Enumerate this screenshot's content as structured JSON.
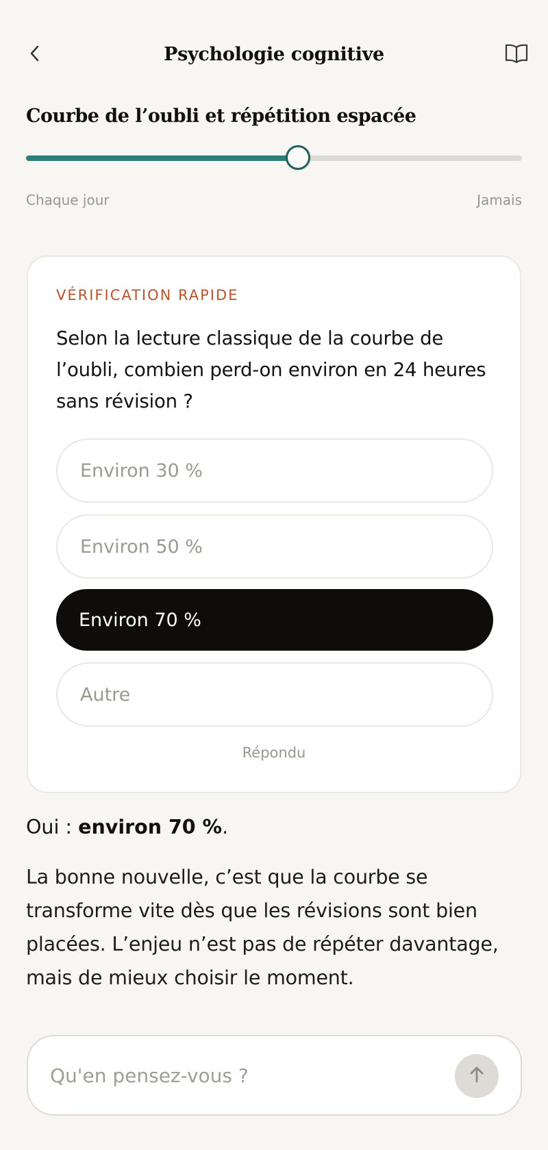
{
  "header": {
    "title": "Psychologie cognitive",
    "back_icon": "chevron-left-icon",
    "book_icon": "open-book-icon"
  },
  "lesson": {
    "title": "Courbe de l’oubli et répétition espacée"
  },
  "slider": {
    "value_fraction": 0.55,
    "min_label": "Chaque jour",
    "max_label": "Jamais",
    "fill_color": "#2f7d7c"
  },
  "quiz": {
    "eyebrow": "VÉRIFICATION RAPIDE",
    "question": "Selon la lecture classique de la courbe de l’oubli, combien perd-on environ en 24 heures sans révision ?",
    "options": [
      {
        "label": "Environ 30 %",
        "selected": false
      },
      {
        "label": "Environ 50 %",
        "selected": false
      },
      {
        "label": "Environ 70 %",
        "selected": true
      },
      {
        "label": "Autre",
        "selected": false
      }
    ],
    "status": "Répondu",
    "accent_color": "#b8542d"
  },
  "feedback": {
    "prefix": "Oui : ",
    "answer": "environ 70 %",
    "suffix": ".",
    "explanation": "La bonne nouvelle, c’est que la courbe se transforme vite dès que les révisions sont bien placées. L’enjeu n’est pas de répéter davantage, mais de mieux choisir le moment."
  },
  "composer": {
    "placeholder": "Qu'en pensez-vous ?",
    "value": "",
    "send_icon": "arrow-up-icon"
  }
}
